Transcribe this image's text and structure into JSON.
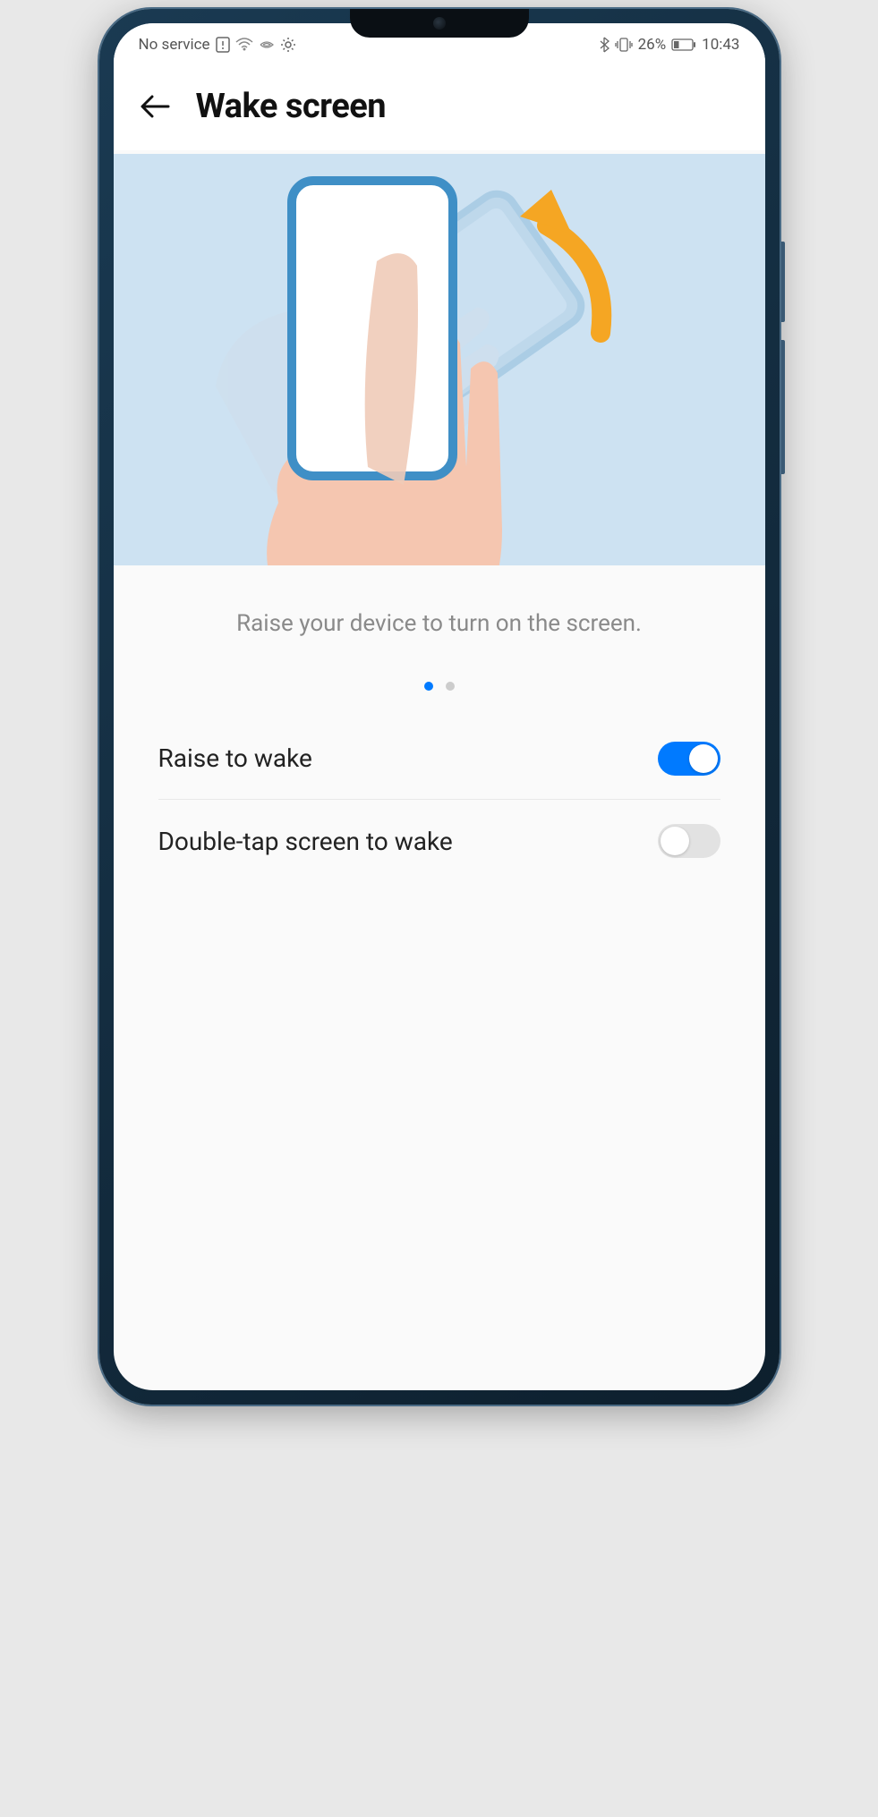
{
  "status_bar": {
    "service_text": "No service",
    "battery_percent": "26%",
    "time": "10:43",
    "icons_left": [
      "sim-alert-icon",
      "wifi-icon",
      "signal-icon",
      "gear-icon"
    ],
    "icons_right": [
      "bluetooth-icon",
      "vibrate-icon"
    ]
  },
  "header": {
    "title": "Wake screen"
  },
  "illustration": {
    "caption": "Raise your device to turn on the screen."
  },
  "pager": {
    "count": 2,
    "active_index": 0
  },
  "settings": [
    {
      "key": "raise_to_wake",
      "label": "Raise to wake",
      "enabled": true
    },
    {
      "key": "double_tap_to_wake",
      "label": "Double-tap screen to wake",
      "enabled": false
    }
  ]
}
